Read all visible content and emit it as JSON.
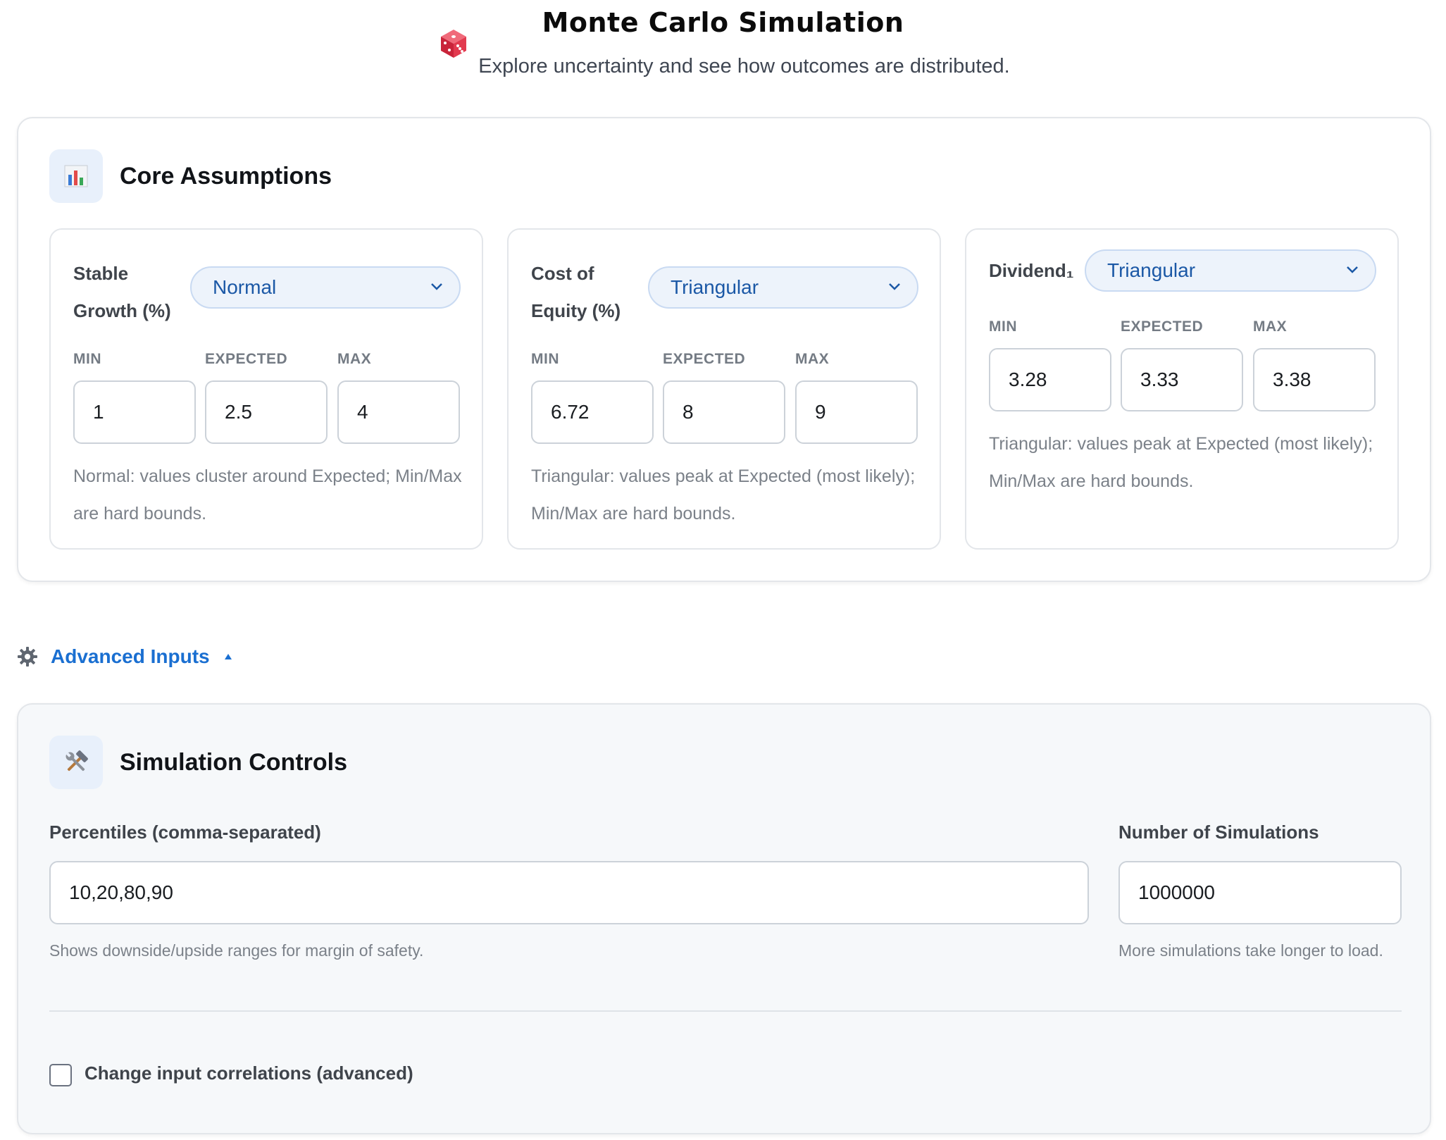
{
  "header": {
    "title": "Monte Carlo Simulation",
    "subtitle": "Explore uncertainty and see how outcomes are distributed.",
    "icon": "dice-icon"
  },
  "core": {
    "title": "Core Assumptions",
    "icon": "bar-chart-icon",
    "field_labels": {
      "min": "MIN",
      "expected": "EXPECTED",
      "max": "MAX"
    },
    "variables": [
      {
        "label": "Stable Growth (%)",
        "distribution": "Normal",
        "min": "1",
        "expected": "2.5",
        "max": "4",
        "hint": "Normal: values cluster around Expected; Min/Max are hard bounds."
      },
      {
        "label": "Cost of Equity (%)",
        "distribution": "Triangular",
        "min": "6.72",
        "expected": "8",
        "max": "9",
        "hint": "Triangular: values peak at Expected (most likely); Min/Max are hard bounds."
      },
      {
        "label": "Dividend₁",
        "distribution": "Triangular",
        "min": "3.28",
        "expected": "3.33",
        "max": "3.38",
        "hint": "Triangular: values peak at Expected (most likely); Min/Max are hard bounds."
      }
    ]
  },
  "advanced": {
    "toggle_label": "Advanced Inputs",
    "icon": "gear-icon",
    "expanded": true
  },
  "controls": {
    "title": "Simulation Controls",
    "icon": "tools-icon",
    "percentiles": {
      "label": "Percentiles (comma-separated)",
      "value": "10,20,80,90",
      "hint": "Shows downside/upside ranges for margin of safety."
    },
    "simulations": {
      "label": "Number of Simulations",
      "value": "1000000",
      "hint": "More simulations take longer to load."
    },
    "correlations": {
      "label": "Change input correlations (advanced)",
      "checked": false
    }
  },
  "colors": {
    "accent": "#1a6fd1",
    "select_bg": "#edf3fb",
    "select_text": "#1b58a6"
  }
}
